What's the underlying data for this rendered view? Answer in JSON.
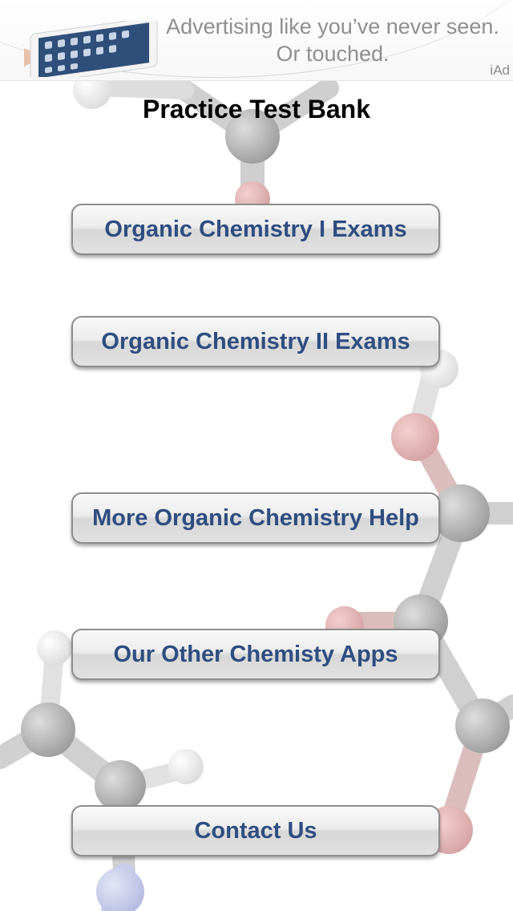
{
  "ad": {
    "line1": "Advertising like you’ve never seen.",
    "line2": "Or touched.",
    "tag": "iAd"
  },
  "title": "Practice Test Bank",
  "buttons": {
    "orgo1": "Organic Chemistry I Exams",
    "orgo2": "Organic Chemistry II Exams",
    "help": "More Organic Chemistry Help",
    "apps": "Our Other Chemisty Apps",
    "contact": "Contact Us"
  },
  "colors": {
    "button_text": "#2e4d80",
    "title_text": "#000000",
    "ad_text": "#8f8f8f"
  }
}
